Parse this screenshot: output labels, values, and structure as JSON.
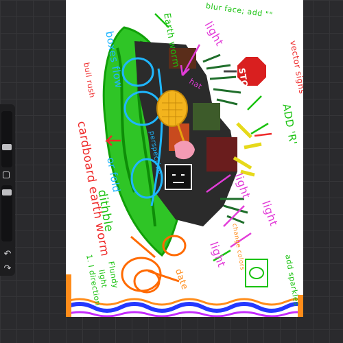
{
  "annotations": {
    "blur_face": "blur face; add \"\"",
    "earth_worm": "Earth worm",
    "light_top": "light",
    "vector_signs": "vector signs",
    "add_r": "ADD 'R'",
    "boxes_flow": "boxes flow",
    "bulrush": "bull rush",
    "cardboard": "cardboard earth worm",
    "hat_mid": "hat",
    "perspective": "perspective",
    "or_fold": "or fold",
    "dithble": "dithble",
    "light_mid": "light",
    "light_right": "light",
    "light_low": "light",
    "change_colors": "change colors",
    "add_sparkles": "add sparkles",
    "flutter": "1. I direction",
    "light_bottom": "light",
    "flutter2": "Flundy",
    "date": "date",
    "stop_sign": "STOP"
  },
  "colors": {
    "bg": "#2a2a2d",
    "canvas": "#ffffff",
    "green": "#19c20f",
    "blue": "#1fb6ff",
    "magenta": "#e23cd8",
    "orange": "#ff6a00",
    "red": "#ee2a2a"
  },
  "sidebar": {
    "brush_size_level": 0.45,
    "opacity_level": 0.5,
    "undo_icon": "undo-icon",
    "redo_icon": "redo-icon",
    "modify_icon": "square-icon"
  }
}
